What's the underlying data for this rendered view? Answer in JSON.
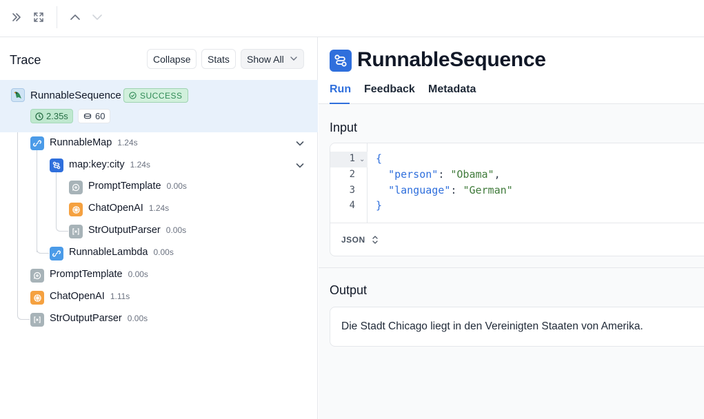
{
  "toolbar": {
    "icons": [
      "double-chevron-right-icon",
      "expand-icon",
      "chevron-up-icon",
      "chevron-down-icon"
    ]
  },
  "trace_panel": {
    "title": "Trace",
    "buttons": {
      "collapse": "Collapse",
      "stats": "Stats",
      "show_all": "Show All"
    },
    "root": {
      "name": "RunnableSequence",
      "status": "SUCCESS",
      "latency": "2.35s",
      "tokens": "60"
    },
    "nodes": [
      {
        "name": "RunnableMap",
        "time": "1.24s",
        "icon": "link-icon"
      },
      {
        "name": "map:key:city",
        "time": "1.24s",
        "icon": "sequence-icon"
      },
      {
        "name": "PromptTemplate",
        "time": "0.00s",
        "icon": "prompt-icon"
      },
      {
        "name": "ChatOpenAI",
        "time": "1.24s",
        "icon": "openai-icon"
      },
      {
        "name": "StrOutputParser",
        "time": "0.00s",
        "icon": "parser-icon"
      },
      {
        "name": "RunnableLambda",
        "time": "0.00s",
        "icon": "link-icon"
      },
      {
        "name": "PromptTemplate",
        "time": "0.00s",
        "icon": "prompt-icon"
      },
      {
        "name": "ChatOpenAI",
        "time": "1.11s",
        "icon": "openai-icon"
      },
      {
        "name": "StrOutputParser",
        "time": "0.00s",
        "icon": "parser-icon"
      }
    ]
  },
  "detail": {
    "title": "RunnableSequence",
    "tabs": [
      "Run",
      "Feedback",
      "Metadata"
    ],
    "active_tab": "Run",
    "input": {
      "heading": "Input",
      "line_numbers": [
        "1",
        "2",
        "3",
        "4"
      ],
      "open_brace": "{",
      "close_brace": "}",
      "fields": [
        {
          "key": "\"person\"",
          "value": "\"Obama\""
        },
        {
          "key": "\"language\"",
          "value": "\"German\""
        }
      ],
      "format": "JSON"
    },
    "output": {
      "heading": "Output",
      "text": "Die Stadt Chicago liegt in den Vereinigten Staaten von Amerika."
    }
  },
  "colors": {
    "accent": "#2f6fdc",
    "success_bg": "#d1f0dc",
    "success_text": "#2f8a55",
    "selected_row": "#e8f1fb"
  }
}
